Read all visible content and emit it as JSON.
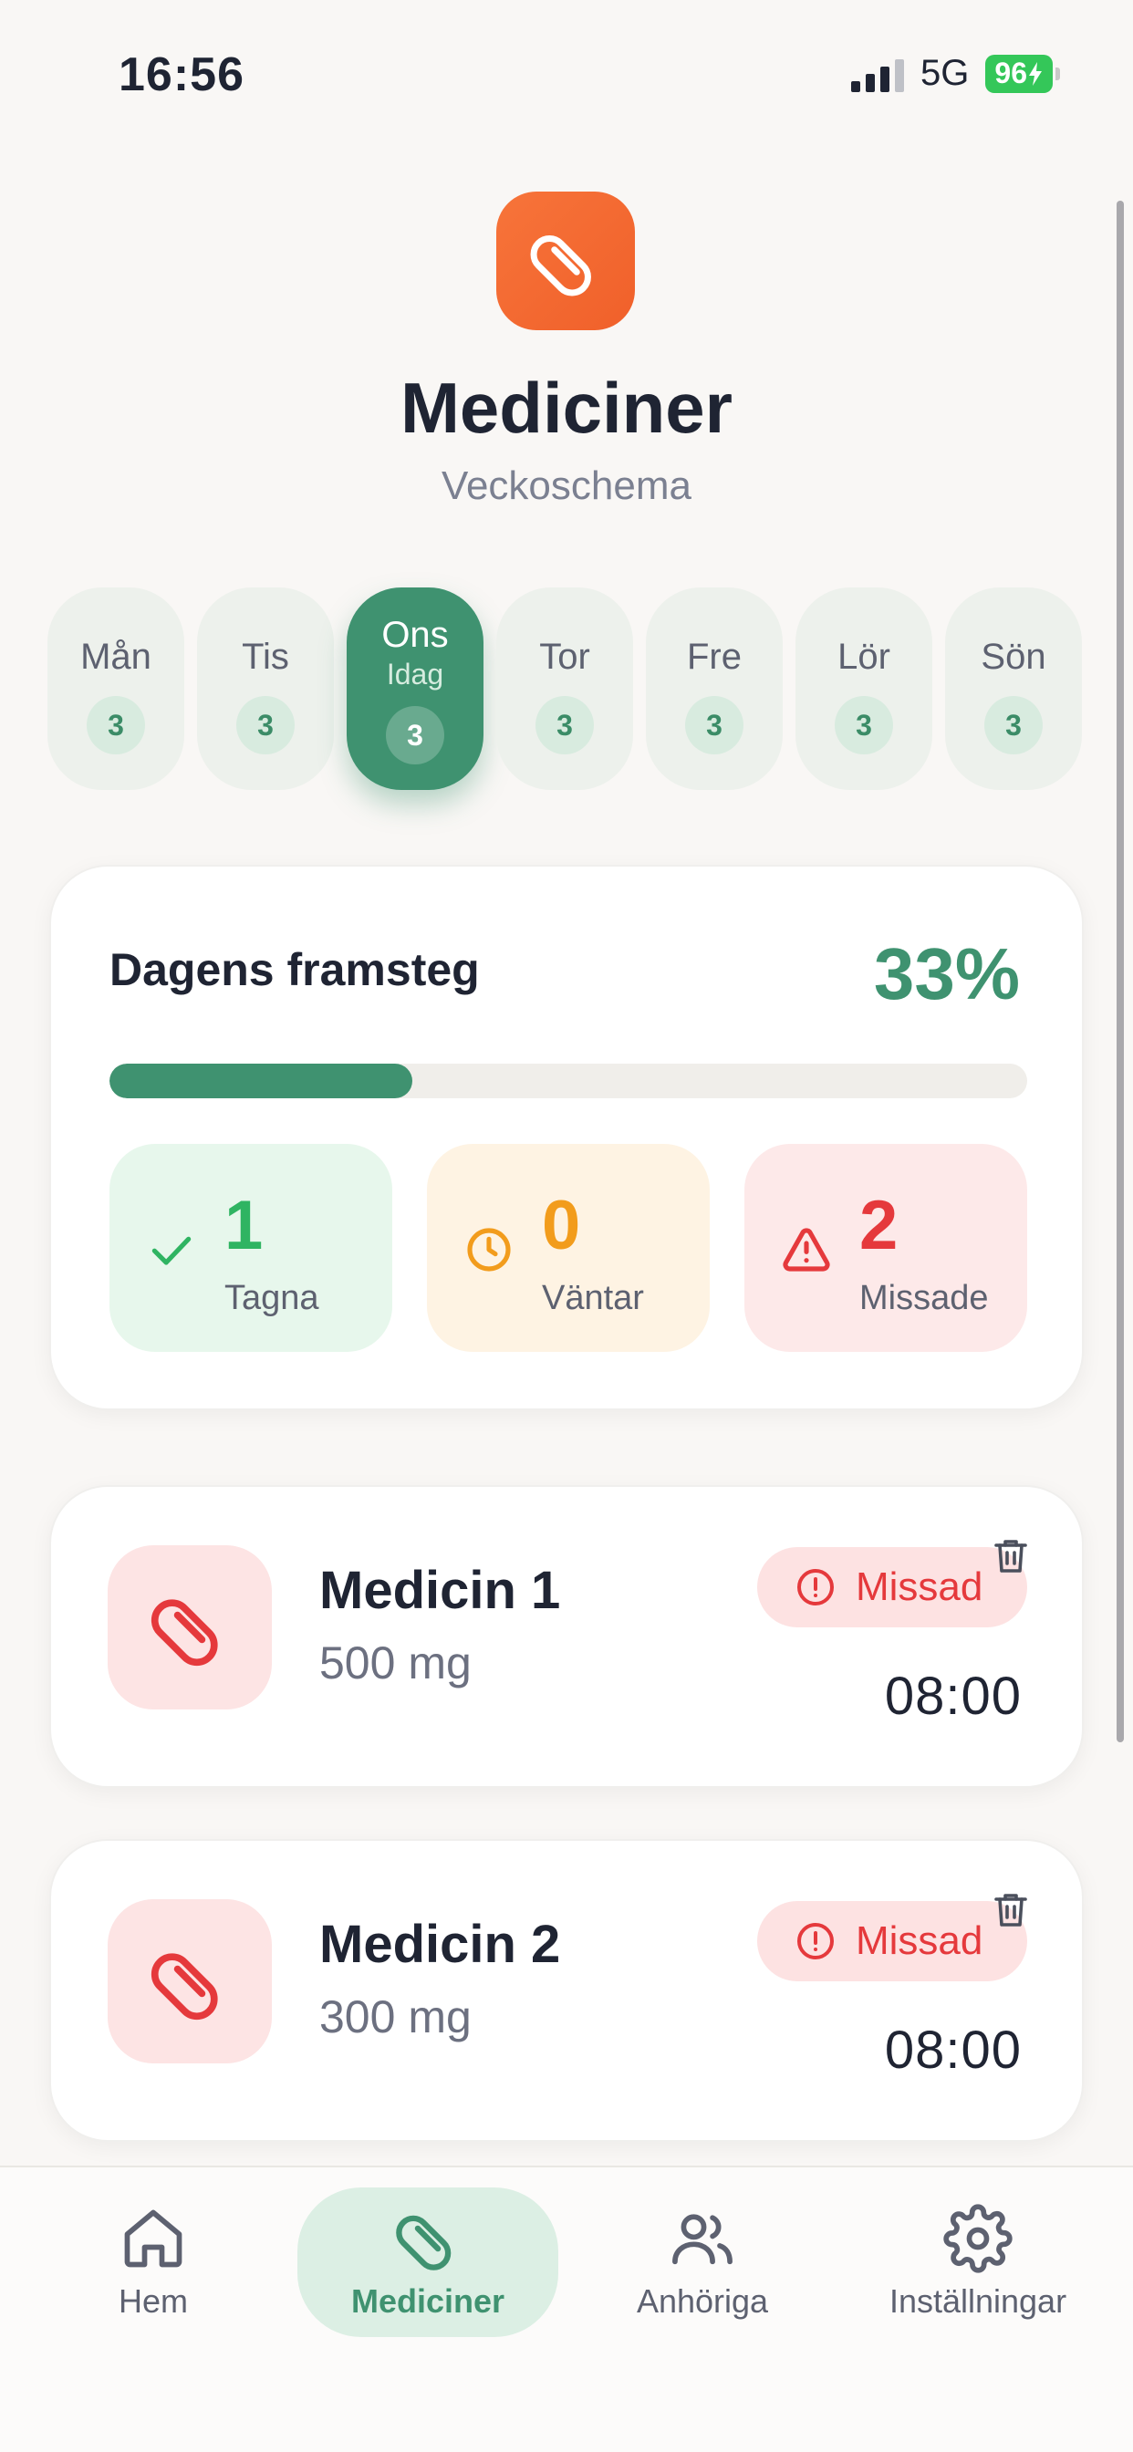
{
  "status_bar": {
    "time": "16:56",
    "network": "5G",
    "battery": "96"
  },
  "header": {
    "icon": "pill-icon",
    "title": "Mediciner",
    "subtitle": "Veckoschema"
  },
  "days": [
    {
      "label": "Mån",
      "count": "3"
    },
    {
      "label": "Tis",
      "count": "3"
    },
    {
      "label": "Ons",
      "sub": "Idag",
      "count": "3",
      "active": true
    },
    {
      "label": "Tor",
      "count": "3"
    },
    {
      "label": "Fre",
      "count": "3"
    },
    {
      "label": "Lör",
      "count": "3"
    },
    {
      "label": "Sön",
      "count": "3"
    }
  ],
  "progress": {
    "title": "Dagens framsteg",
    "percent": "33%",
    "fraction": 0.33,
    "stats": {
      "taken": {
        "value": "1",
        "label": "Tagna"
      },
      "waiting": {
        "value": "0",
        "label": "Väntar"
      },
      "missed": {
        "value": "2",
        "label": "Missade"
      }
    }
  },
  "medicines": [
    {
      "name": "Medicin 1",
      "dose": "500 mg",
      "status": "Missad",
      "time": "08:00"
    },
    {
      "name": "Medicin 2",
      "dose": "300 mg",
      "status": "Missad",
      "time": "08:00"
    }
  ],
  "tabs": [
    {
      "label": "Hem",
      "icon": "home-icon"
    },
    {
      "label": "Mediciner",
      "icon": "pill-icon",
      "active": true
    },
    {
      "label": "Anhöriga",
      "icon": "users-icon"
    },
    {
      "label": "Inställningar",
      "icon": "gear-icon"
    }
  ],
  "colors": {
    "primary": "#3f9270",
    "accent": "#f0602a",
    "taken": "#2fb462",
    "waiting": "#f29c1c",
    "missed": "#e5393c"
  }
}
